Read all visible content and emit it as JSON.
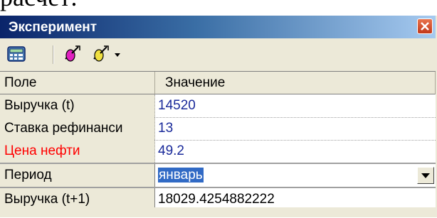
{
  "background_text": "расчёт:",
  "window": {
    "title": "Эксперимент",
    "close_icon": "close-icon"
  },
  "toolbar": {
    "buttons": [
      {
        "name": "calculator-icon"
      },
      {
        "name": "pin-magenta-icon"
      },
      {
        "name": "pin-yellow-dropdown-icon"
      }
    ]
  },
  "grid": {
    "header": {
      "field": "Поле",
      "value": "Значение"
    },
    "rows": [
      {
        "name": "Выручка (t)",
        "value": "14520",
        "name_color": "#000000"
      },
      {
        "name": "Ставка рефинанси",
        "value": "13",
        "name_color": "#000000"
      },
      {
        "name": "Цена нефти",
        "value": "49.2",
        "name_color": "#ff0000"
      },
      {
        "name": "Период",
        "value": "январь",
        "name_color": "#000000"
      },
      {
        "name": "Выручка (t+1)",
        "value": "18029.4254882222",
        "name_color": "#000000"
      }
    ]
  },
  "colors": {
    "title_gradient_start": "#0a246a",
    "value_text": "#1a2a9a",
    "selection": "#316ac5",
    "red_label": "#ff0000"
  }
}
